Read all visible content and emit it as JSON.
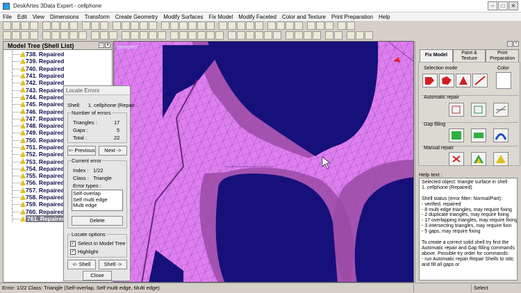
{
  "window": {
    "title": "DeskArtes 3Data Expert - cellphone"
  },
  "menu": [
    "File",
    "Edit",
    "View",
    "Dimensions",
    "Transform",
    "Create Geometry",
    "Modify Surfaces",
    "Fix Model",
    "Modify Faceted",
    "Color and Texture",
    "Print Preparation",
    "Help"
  ],
  "tree": {
    "title": "Model Tree (Shell List)",
    "items": [
      {
        "label": "738. Repaired"
      },
      {
        "label": "739. Repaired"
      },
      {
        "label": "740. Repaired"
      },
      {
        "label": "741. Repaired"
      },
      {
        "label": "742. Repaired"
      },
      {
        "label": "743. Repaired"
      },
      {
        "label": "744. Repaired"
      },
      {
        "label": "745. Repaired"
      },
      {
        "label": "746. Repaired"
      },
      {
        "label": "747. Repaired"
      },
      {
        "label": "748. Repaired"
      },
      {
        "label": "749. Repaired"
      },
      {
        "label": "750. Repaired"
      },
      {
        "label": "751. Repaired"
      },
      {
        "label": "752. Repaired"
      },
      {
        "label": "753. Repaired"
      },
      {
        "label": "754. Repaired"
      },
      {
        "label": "755. Repaired"
      },
      {
        "label": "756. Repaired"
      },
      {
        "label": "757. Repaired"
      },
      {
        "label": "758. Repaired"
      },
      {
        "label": "759. Repaired"
      },
      {
        "label": "760. Repaired"
      },
      {
        "label": "761. Repaired",
        "selected": true
      }
    ]
  },
  "viewport": {
    "label": "perspect"
  },
  "dialog": {
    "title": "Locate Errors",
    "shell_label": "Shell:",
    "shell_value": "1. cellphone (Repair",
    "num_errors_label": "Number of errors",
    "triangles_label": "Triangles :",
    "triangles_value": "17",
    "gaps_label": "Gaps :",
    "gaps_value": "5",
    "total_label": "Total :",
    "total_value": "22",
    "prev_btn": "<- Previous",
    "next_btn": "Next ->",
    "current_error_label": "Current error",
    "index_label": "Index :",
    "index_value": "1/22",
    "class_label": "Class :",
    "class_value": "Triangle",
    "error_types_label": "Error types :",
    "error_types": [
      "Self-overlap",
      "Self multi edge",
      "Multi edge"
    ],
    "delete_btn": "Delete",
    "locate_options_label": "Locate options",
    "select_in_tree_label": "Select in Model Tree",
    "highlight_label": "Highlight",
    "shell_prev_btn": "<- Shell",
    "shell_next_btn": "Shell ->",
    "close_btn": "Close"
  },
  "right_panel": {
    "tabs": [
      "Fix Model",
      "Paint & Texture",
      "Print Preparation"
    ],
    "selection_mode_label": "Selection mode",
    "color_label": "Color",
    "automatic_repair_label": "Automatic repair",
    "gap_filling_label": "Gap filling",
    "manual_repair_label": "Manual repair",
    "help_label": "Help text :",
    "help_lines": [
      "Selected object: triangle surface in shell",
      "1. cellphone (Repaired)",
      "",
      "Shell status (error filter: Normal/Part):",
      "- verified, repaired",
      "- 8 multi edge triangles,  may require fixing",
      "- 2 duplicate triangles,  may require fixing",
      "- 17 overlapping triangles,  may require fixing",
      "- 3 intersecting triangles,  may require fixin",
      "- 5 gaps,  may require fixing",
      "",
      "To create a correct solid shell try first the",
      "Automatic repair and Gap filling commands",
      "above. Possible try order for commands:",
      "- run Automatic repair Repair Shells to stitc",
      "  and fill all gaps or"
    ]
  },
  "status": {
    "left": "Error: 1/22 Class: Triangle (Self-overlap, Self multi edge, Multi edge)",
    "right": "Select"
  },
  "colors": {
    "viewport_bg": "#16107a",
    "mesh_fill": "#e07ef0",
    "mesh_shade": "#9a4aa6"
  }
}
